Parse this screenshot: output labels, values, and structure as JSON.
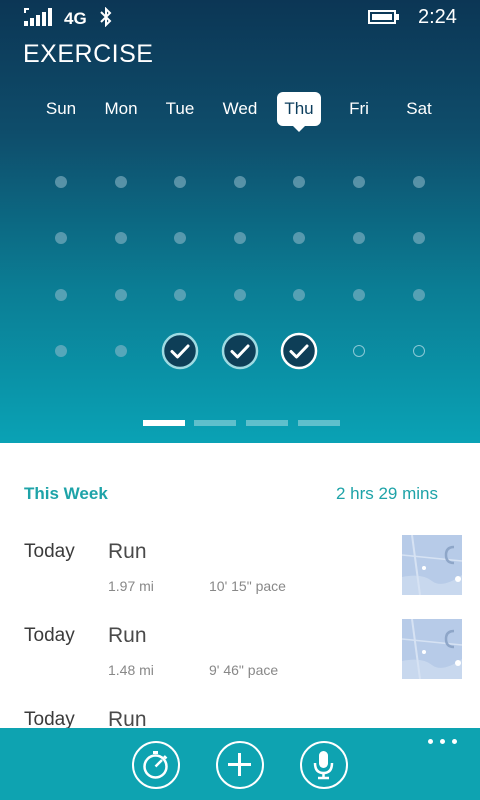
{
  "status_bar": {
    "network": "4G",
    "time": "2:24"
  },
  "header": {
    "title": "EXERCISE"
  },
  "week_days": [
    "Sun",
    "Mon",
    "Tue",
    "Wed",
    "Thu",
    "Fri",
    "Sat"
  ],
  "selected_day": "Thu",
  "completed_days": [
    "Tue",
    "Wed",
    "Thu"
  ],
  "pager": {
    "pages": 4,
    "active": 0
  },
  "summary": {
    "label": "This Week",
    "total": "2 hrs 29 mins"
  },
  "activities": [
    {
      "day": "Today",
      "name": "Run",
      "distance": "1.97 mi",
      "pace": "10' 15\" pace"
    },
    {
      "day": "Today",
      "name": "Run",
      "distance": "1.48 mi",
      "pace": "9' 46\" pace"
    },
    {
      "day": "Today",
      "name": "Run",
      "distance": "",
      "pace": ""
    }
  ],
  "app_bar": {
    "buttons": [
      "stopwatch-icon",
      "plus-icon",
      "microphone-icon"
    ]
  },
  "colors": {
    "accent": "#1ea3a8",
    "app_bar": "#0ea3b1",
    "header_top": "#0c3655",
    "header_bottom": "#0aa2b5"
  }
}
